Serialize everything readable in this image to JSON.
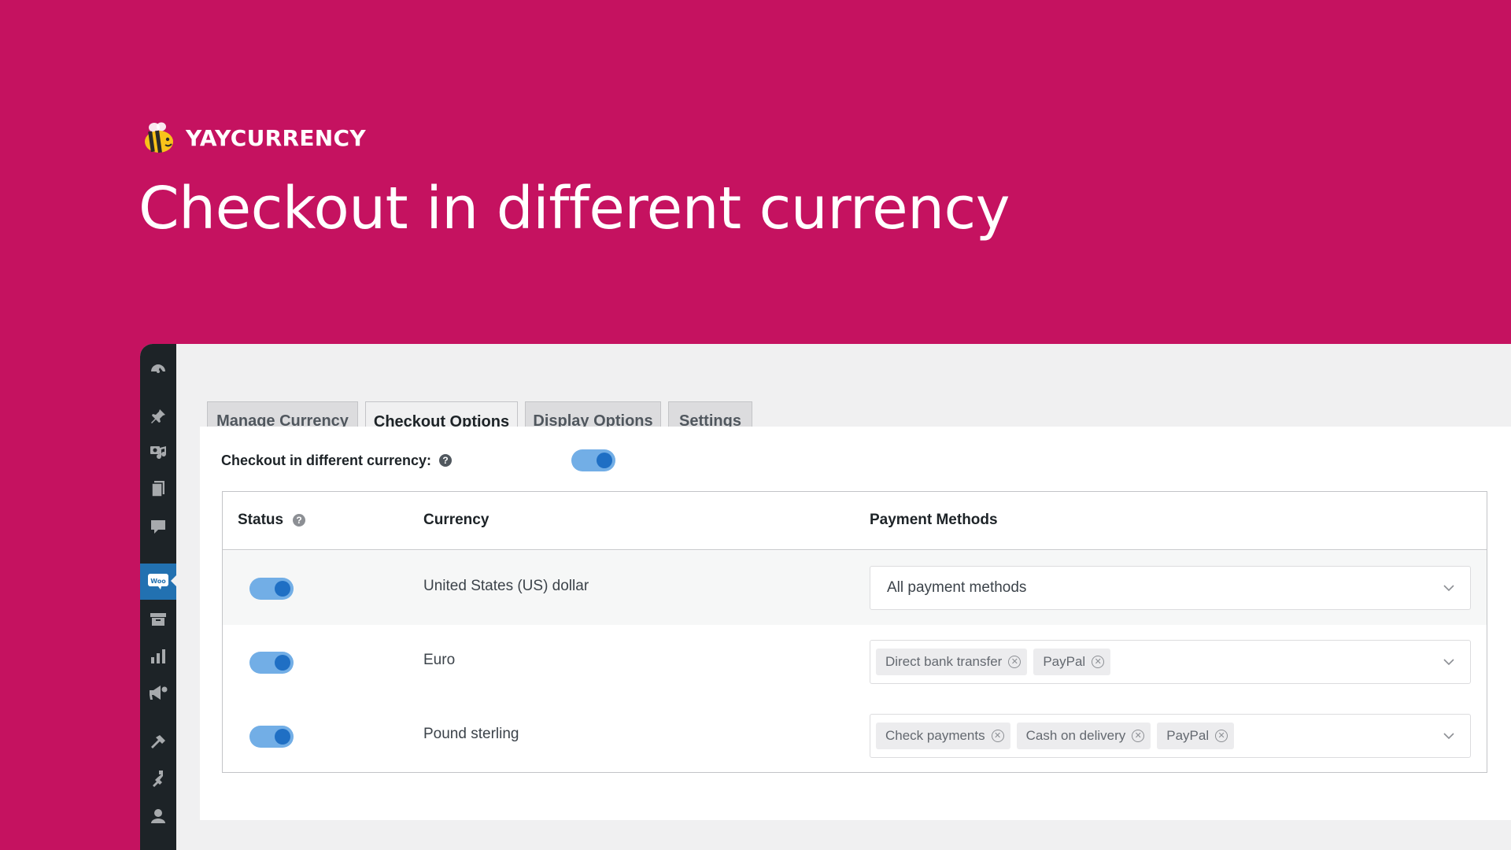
{
  "brand": {
    "name": "YAYCURRENCY"
  },
  "hero": {
    "title": "Checkout in different currency"
  },
  "tabs": [
    {
      "label": "Manage Currency",
      "active": false
    },
    {
      "label": "Checkout Options",
      "active": true
    },
    {
      "label": "Display Options",
      "active": false
    },
    {
      "label": "Settings",
      "active": false
    }
  ],
  "panel": {
    "toggle_label": "Checkout in different currency:",
    "toggle_on": true,
    "help_glyph": "?"
  },
  "table": {
    "headers": {
      "status": "Status",
      "currency": "Currency",
      "payment_methods": "Payment Methods"
    },
    "rows": [
      {
        "status_on": true,
        "currency": "United States (US) dollar",
        "payment_value": "All payment methods",
        "chips": []
      },
      {
        "status_on": true,
        "currency": "Euro",
        "payment_value": "",
        "chips": [
          "Direct bank transfer",
          "PayPal"
        ]
      },
      {
        "status_on": true,
        "currency": "Pound sterling",
        "payment_value": "",
        "chips": [
          "Check payments",
          "Cash on delivery",
          "PayPal"
        ]
      }
    ]
  },
  "sidebar": {
    "icons": [
      "dashboard-icon",
      "pin-icon",
      "media-icon",
      "pages-icon",
      "comments-icon",
      "woocommerce-icon",
      "products-icon",
      "analytics-icon",
      "marketing-icon",
      "appearance-icon",
      "plugins-icon",
      "users-icon"
    ],
    "woo_label": "Woo"
  },
  "colors": {
    "background": "#c51260",
    "sidebar": "#1d2327",
    "toggle_track": "#72aee6",
    "toggle_knob": "#1f6fc4",
    "active_menu": "#2271b1"
  }
}
